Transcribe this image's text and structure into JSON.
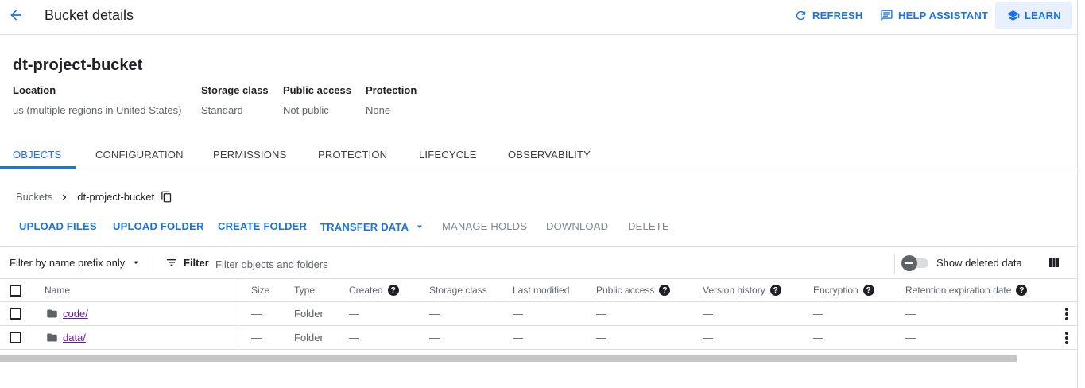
{
  "header": {
    "title": "Bucket details",
    "refresh_label": "REFRESH",
    "help_assistant_label": "HELP ASSISTANT",
    "learn_label": "LEARN"
  },
  "bucket": {
    "name": "dt-project-bucket",
    "meta": [
      {
        "key": "Location",
        "value": "us (multiple regions in United States)"
      },
      {
        "key": "Storage class",
        "value": "Standard"
      },
      {
        "key": "Public access",
        "value": "Not public"
      },
      {
        "key": "Protection",
        "value": "None"
      }
    ]
  },
  "tabs": [
    "OBJECTS",
    "CONFIGURATION",
    "PERMISSIONS",
    "PROTECTION",
    "LIFECYCLE",
    "OBSERVABILITY"
  ],
  "active_tab": "OBJECTS",
  "breadcrumb": {
    "root": "Buckets",
    "current": "dt-project-bucket"
  },
  "actions": [
    {
      "label": "UPLOAD FILES",
      "enabled": true
    },
    {
      "label": "UPLOAD FOLDER",
      "enabled": true
    },
    {
      "label": "CREATE FOLDER",
      "enabled": true
    },
    {
      "label": "TRANSFER DATA",
      "enabled": true
    },
    {
      "label": "MANAGE HOLDS",
      "enabled": false
    },
    {
      "label": "DOWNLOAD",
      "enabled": false
    },
    {
      "label": "DELETE",
      "enabled": false
    }
  ],
  "filter": {
    "mode_label": "Filter by name prefix only",
    "filter_label": "Filter",
    "placeholder": "Filter objects and folders",
    "show_deleted_label": "Show deleted data"
  },
  "table": {
    "columns": [
      "Name",
      "Size",
      "Type",
      "Created",
      "Storage class",
      "Last modified",
      "Public access",
      "Version history",
      "Encryption",
      "Retention expiration date"
    ],
    "rows": [
      {
        "name": "code/",
        "size": "—",
        "type": "Folder",
        "created": "—",
        "storage_class": "—",
        "last_modified": "—",
        "public_access": "—",
        "version_history": "—",
        "encryption": "—",
        "retention": "—"
      },
      {
        "name": "data/",
        "size": "—",
        "type": "Folder",
        "created": "—",
        "storage_class": "—",
        "last_modified": "—",
        "public_access": "—",
        "version_history": "—",
        "encryption": "—",
        "retention": "—"
      }
    ]
  },
  "colors": {
    "accent": "#1a73e8",
    "link_visited": "#681da8",
    "text": "#202124",
    "muted": "#5f6368"
  }
}
